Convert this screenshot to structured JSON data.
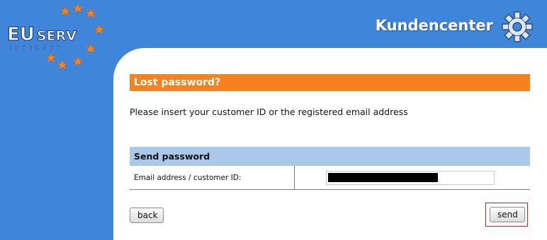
{
  "logo": {
    "brand": "EUSERV",
    "subtitle": "INTERNET"
  },
  "header": {
    "title": "Kundencenter",
    "icon": "gear-icon"
  },
  "main": {
    "section_title": "Lost password?",
    "intro": "Please insert your customer ID or the registered email address",
    "form": {
      "header": "Send password",
      "field_label": "Email address / customer ID:",
      "field_value": "[redacted]"
    },
    "buttons": {
      "back": "back",
      "send": "send"
    }
  },
  "colors": {
    "background": "#3f86da",
    "section_header": "#f5821f",
    "table_header": "#a9c8ea",
    "highlight_border": "#cc2222"
  }
}
